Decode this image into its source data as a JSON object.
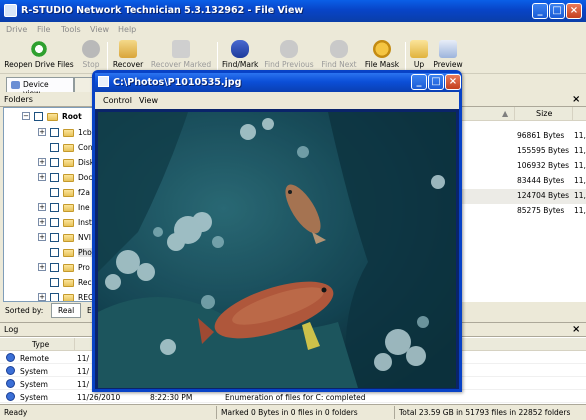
{
  "app": {
    "title": "R-STUDIO Network Technician 5.3.132962 - File View"
  },
  "menu": [
    "Drive",
    "File",
    "Tools",
    "View",
    "Help"
  ],
  "toolbar": {
    "reopen": "Reopen Drive Files",
    "stop": "Stop",
    "recover": "Recover",
    "recover_marked": "Recover Marked",
    "find_mark": "Find/Mark",
    "find_previous": "Find Previous",
    "find_next": "Find Next",
    "file_mask": "File Mask",
    "up": "Up",
    "preview": "Preview"
  },
  "tabs": {
    "device_view": "Device view"
  },
  "folders": {
    "header": "Folders",
    "close": "×",
    "root": "Root",
    "items": [
      "1cb",
      "Con",
      "Disk",
      "Doc",
      "f2a",
      "Ine",
      "Inst",
      "NVI",
      "Pho",
      "Pro",
      "Rec",
      "REC"
    ]
  },
  "filelist": {
    "size_header": "Size",
    "col2_header": "",
    "rows": [
      {
        "size": "96861 Bytes",
        "extra": "11,"
      },
      {
        "size": "155595 Bytes",
        "extra": "11,"
      },
      {
        "size": "106932 Bytes",
        "extra": "11,"
      },
      {
        "size": "83444 Bytes",
        "extra": "11,"
      },
      {
        "size": "124704 Bytes",
        "extra": "11,"
      },
      {
        "size": "85275 Bytes",
        "extra": "11,"
      }
    ]
  },
  "sort": {
    "label": "Sorted by:",
    "real": "Real",
    "e": "E"
  },
  "log": {
    "header": "Log",
    "close": "×",
    "type_col": "Type",
    "rows": [
      {
        "type": "Remote",
        "date": "11/",
        "time": "",
        "event": ""
      },
      {
        "type": "System",
        "date": "11/",
        "time": "",
        "event": ""
      },
      {
        "type": "System",
        "date": "11/",
        "time": "",
        "event": ""
      },
      {
        "type": "System",
        "date": "11/26/2010",
        "time": "8:22:30 PM",
        "event": "Enumeration of files for C: completed"
      }
    ]
  },
  "status": {
    "ready": "Ready",
    "marked": "Marked 0 Bytes in 0 files in 0 folders",
    "total": "Total 23.59 GB in 51793 files in 22852 folders"
  },
  "viewer": {
    "title": "C:\\Photos\\P1010535.jpg",
    "menu_control": "Control",
    "menu_view": "View"
  },
  "colors": {
    "title_blue": "#0a5fe8",
    "xp_face": "#ece9d8",
    "water": "#0f3b4a",
    "fish": "#c45a3a"
  }
}
